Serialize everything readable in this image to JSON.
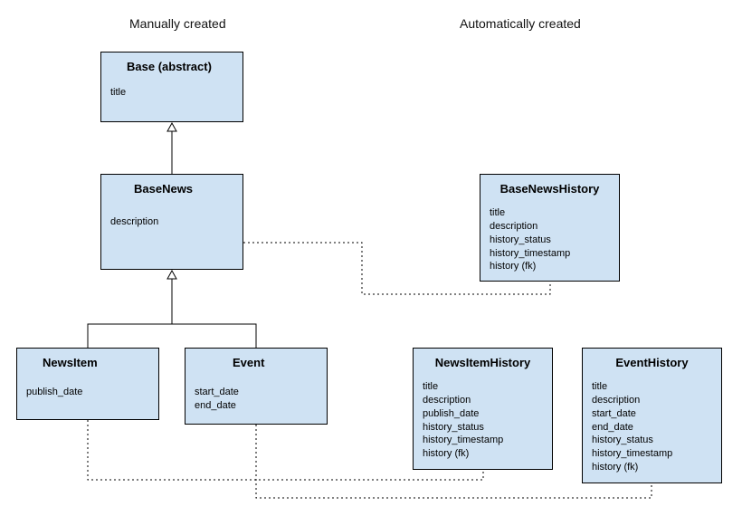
{
  "labels": {
    "left_section": "Manually created",
    "right_section": "Automatically created"
  },
  "classes": {
    "base": {
      "title": "Base (abstract)",
      "fields": [
        "title"
      ]
    },
    "base_news": {
      "title": "BaseNews",
      "fields": [
        "description"
      ]
    },
    "news_item": {
      "title": "NewsItem",
      "fields": [
        "publish_date"
      ]
    },
    "event": {
      "title": "Event",
      "fields": [
        "start_date",
        "end_date"
      ]
    },
    "base_news_history": {
      "title": "BaseNewsHistory",
      "fields": [
        "title",
        "description",
        "history_status",
        "history_timestamp",
        "history (fk)"
      ]
    },
    "news_item_history": {
      "title": "NewsItemHistory",
      "fields": [
        "title",
        "description",
        "publish_date",
        "history_status",
        "history_timestamp",
        "history (fk)"
      ]
    },
    "event_history": {
      "title": "EventHistory",
      "fields": [
        "title",
        "description",
        "start_date",
        "end_date",
        "history_status",
        "history_timestamp",
        "history (fk)"
      ]
    }
  }
}
